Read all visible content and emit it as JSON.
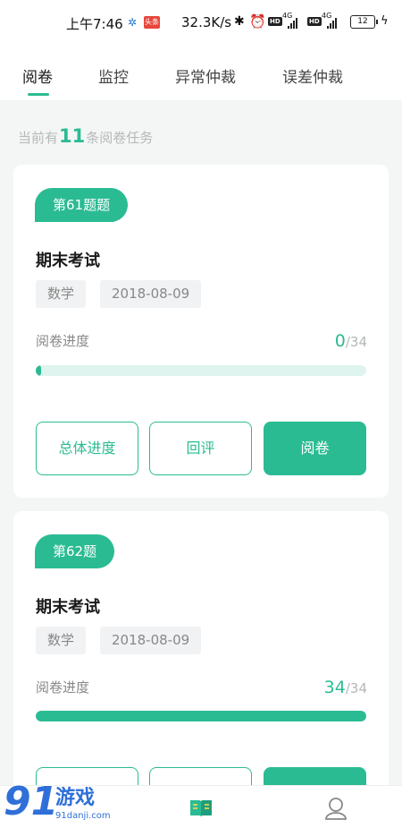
{
  "status_bar": {
    "time": "上午7:46",
    "news_badge": "头条",
    "speed": "32.3K/s",
    "hd1": "HD",
    "net1": "4G",
    "hd2": "HD",
    "net2": "4G",
    "battery": "12"
  },
  "tabs": [
    {
      "label": "阅卷",
      "active": true
    },
    {
      "label": "监控",
      "active": false
    },
    {
      "label": "异常仲裁",
      "active": false
    },
    {
      "label": "误差仲裁",
      "active": false
    }
  ],
  "task_summary": {
    "prefix": "当前有",
    "count": "11",
    "suffix": "条阅卷任务"
  },
  "cards": [
    {
      "question": "第61题题",
      "exam": "期末考试",
      "subject": "数学",
      "date": "2018-08-09",
      "progress_label": "阅卷进度",
      "done": "0",
      "total": "/34",
      "progress_fraction": 0.01,
      "buttons": {
        "overall": "总体进度",
        "review": "回评",
        "grade": "阅卷"
      }
    },
    {
      "question": "第62题",
      "exam": "期末考试",
      "subject": "数学",
      "date": "2018-08-09",
      "progress_label": "阅卷进度",
      "done": "34",
      "total": "/34",
      "progress_fraction": 1.0,
      "buttons": {
        "overall": "",
        "review": "",
        "grade": ""
      }
    }
  ],
  "watermark": {
    "brand": "91游戏",
    "site": "91danji.com"
  },
  "colors": {
    "accent": "#2bbb93",
    "accent_light": "#dff4ee",
    "muted": "#b5b9b8"
  }
}
